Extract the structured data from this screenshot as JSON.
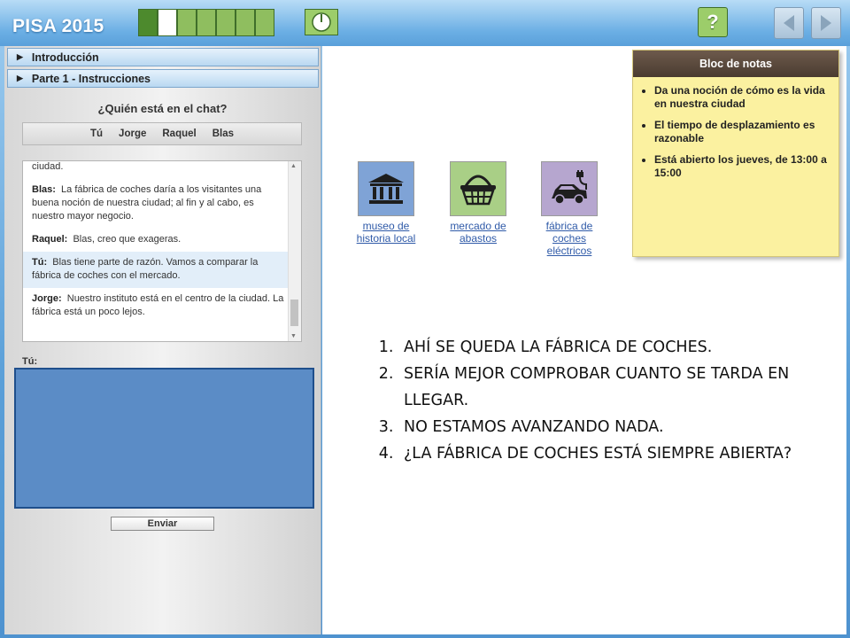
{
  "header": {
    "title": "PISA 2015",
    "progress_segments": [
      "done",
      "current",
      "todo",
      "todo",
      "todo",
      "todo",
      "todo"
    ],
    "help_label": "?"
  },
  "sidebar": {
    "sections": [
      {
        "label": "Introducción"
      },
      {
        "label": "Parte 1 - Instrucciones"
      }
    ],
    "chat_heading": "¿Quién está en el chat?",
    "participants": [
      "Tú",
      "Jorge",
      "Raquel",
      "Blas"
    ],
    "messages": [
      {
        "speaker": "",
        "text": "ciudad.",
        "me": false
      },
      {
        "speaker": "Blas:",
        "text": "La fábrica de coches daría a los visitantes una buena noción de nuestra ciudad; al fin y al cabo, es nuestro mayor negocio.",
        "me": false
      },
      {
        "speaker": "Raquel:",
        "text": "Blas, creo que exageras.",
        "me": false
      },
      {
        "speaker": "Tú:",
        "text": "Blas tiene parte de razón. Vamos a comparar la fábrica de coches con el mercado.",
        "me": true
      },
      {
        "speaker": "Jorge:",
        "text": "Nuestro instituto está en el centro de la ciudad. La fábrica está un poco lejos.",
        "me": false
      }
    ],
    "input_label": "Tú:",
    "send_label": "Enviar"
  },
  "places": [
    {
      "label": "museo de historia local",
      "icon": "museum-icon",
      "color": "#7fa3d6"
    },
    {
      "label": "mercado de abastos",
      "icon": "basket-icon",
      "color": "#a9cf86"
    },
    {
      "label": "fábrica de coches eléctricos",
      "icon": "electric-car-icon",
      "color": "#b6a6cf"
    }
  ],
  "notes": {
    "title": "Bloc de notas",
    "items": [
      "Da una noción de cómo es la vida en nuestra ciudad",
      "El tiempo de desplazamiento es razonable",
      "Está abierto los jueves, de 13:00 a 15:00"
    ]
  },
  "answers": [
    "AHÍ SE QUEDA LA FÁBRICA DE COCHES.",
    "SERÍA MEJOR COMPROBAR CUANTO SE TARDA EN LLEGAR.",
    "NO ESTAMOS AVANZANDO NADA.",
    "¿LA FÁBRICA DE COCHES ESTÁ SIEMPRE ABIERTA?"
  ]
}
